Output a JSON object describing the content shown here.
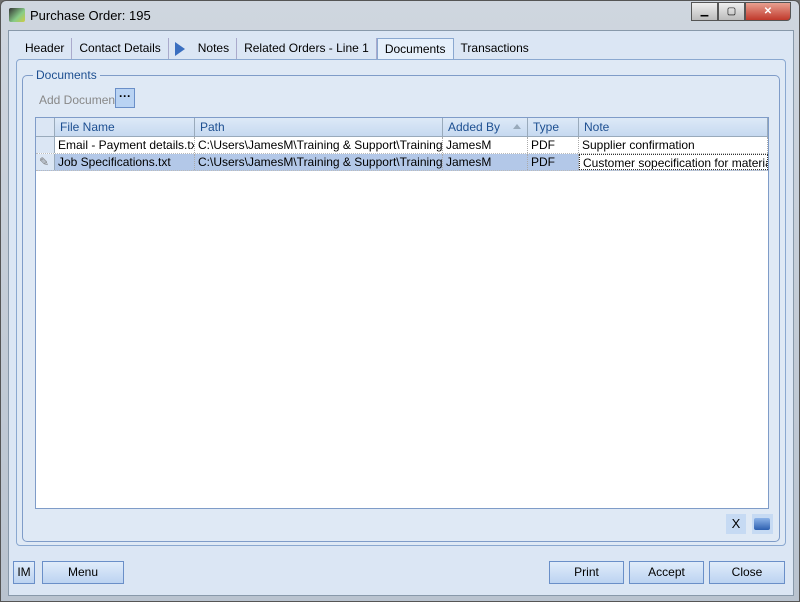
{
  "window": {
    "title": "Purchase Order: 195",
    "minimize": "▁",
    "maximize": "▢",
    "close": "✕"
  },
  "tabs": [
    "Header",
    "Contact Details",
    "Notes",
    "Related Orders - Line 1",
    "Documents",
    "Transactions"
  ],
  "group": {
    "label": "Documents",
    "add_document": "Add Document",
    "ellipsis": "···"
  },
  "grid": {
    "columns": [
      "File Name",
      "Path",
      "Added By",
      "Type",
      "Note"
    ],
    "rows": [
      {
        "file": "Email - Payment details.txt",
        "path": "C:\\Users\\JamesM\\Training & Support\\Training ...",
        "added_by": "JamesM",
        "type": "PDF",
        "note": "Supplier confirmation"
      },
      {
        "file": "Job Specifications.txt",
        "path": "C:\\Users\\JamesM\\Training & Support\\Training ...",
        "added_by": "JamesM",
        "type": "PDF",
        "note": "Customer sopecification for material"
      }
    ],
    "edit_ellipsis": "...",
    "edit_marker": "✎"
  },
  "actions": {
    "delete": "X"
  },
  "footer": {
    "im": "IM",
    "menu": "Menu",
    "print": "Print",
    "accept": "Accept",
    "close": "Close"
  }
}
